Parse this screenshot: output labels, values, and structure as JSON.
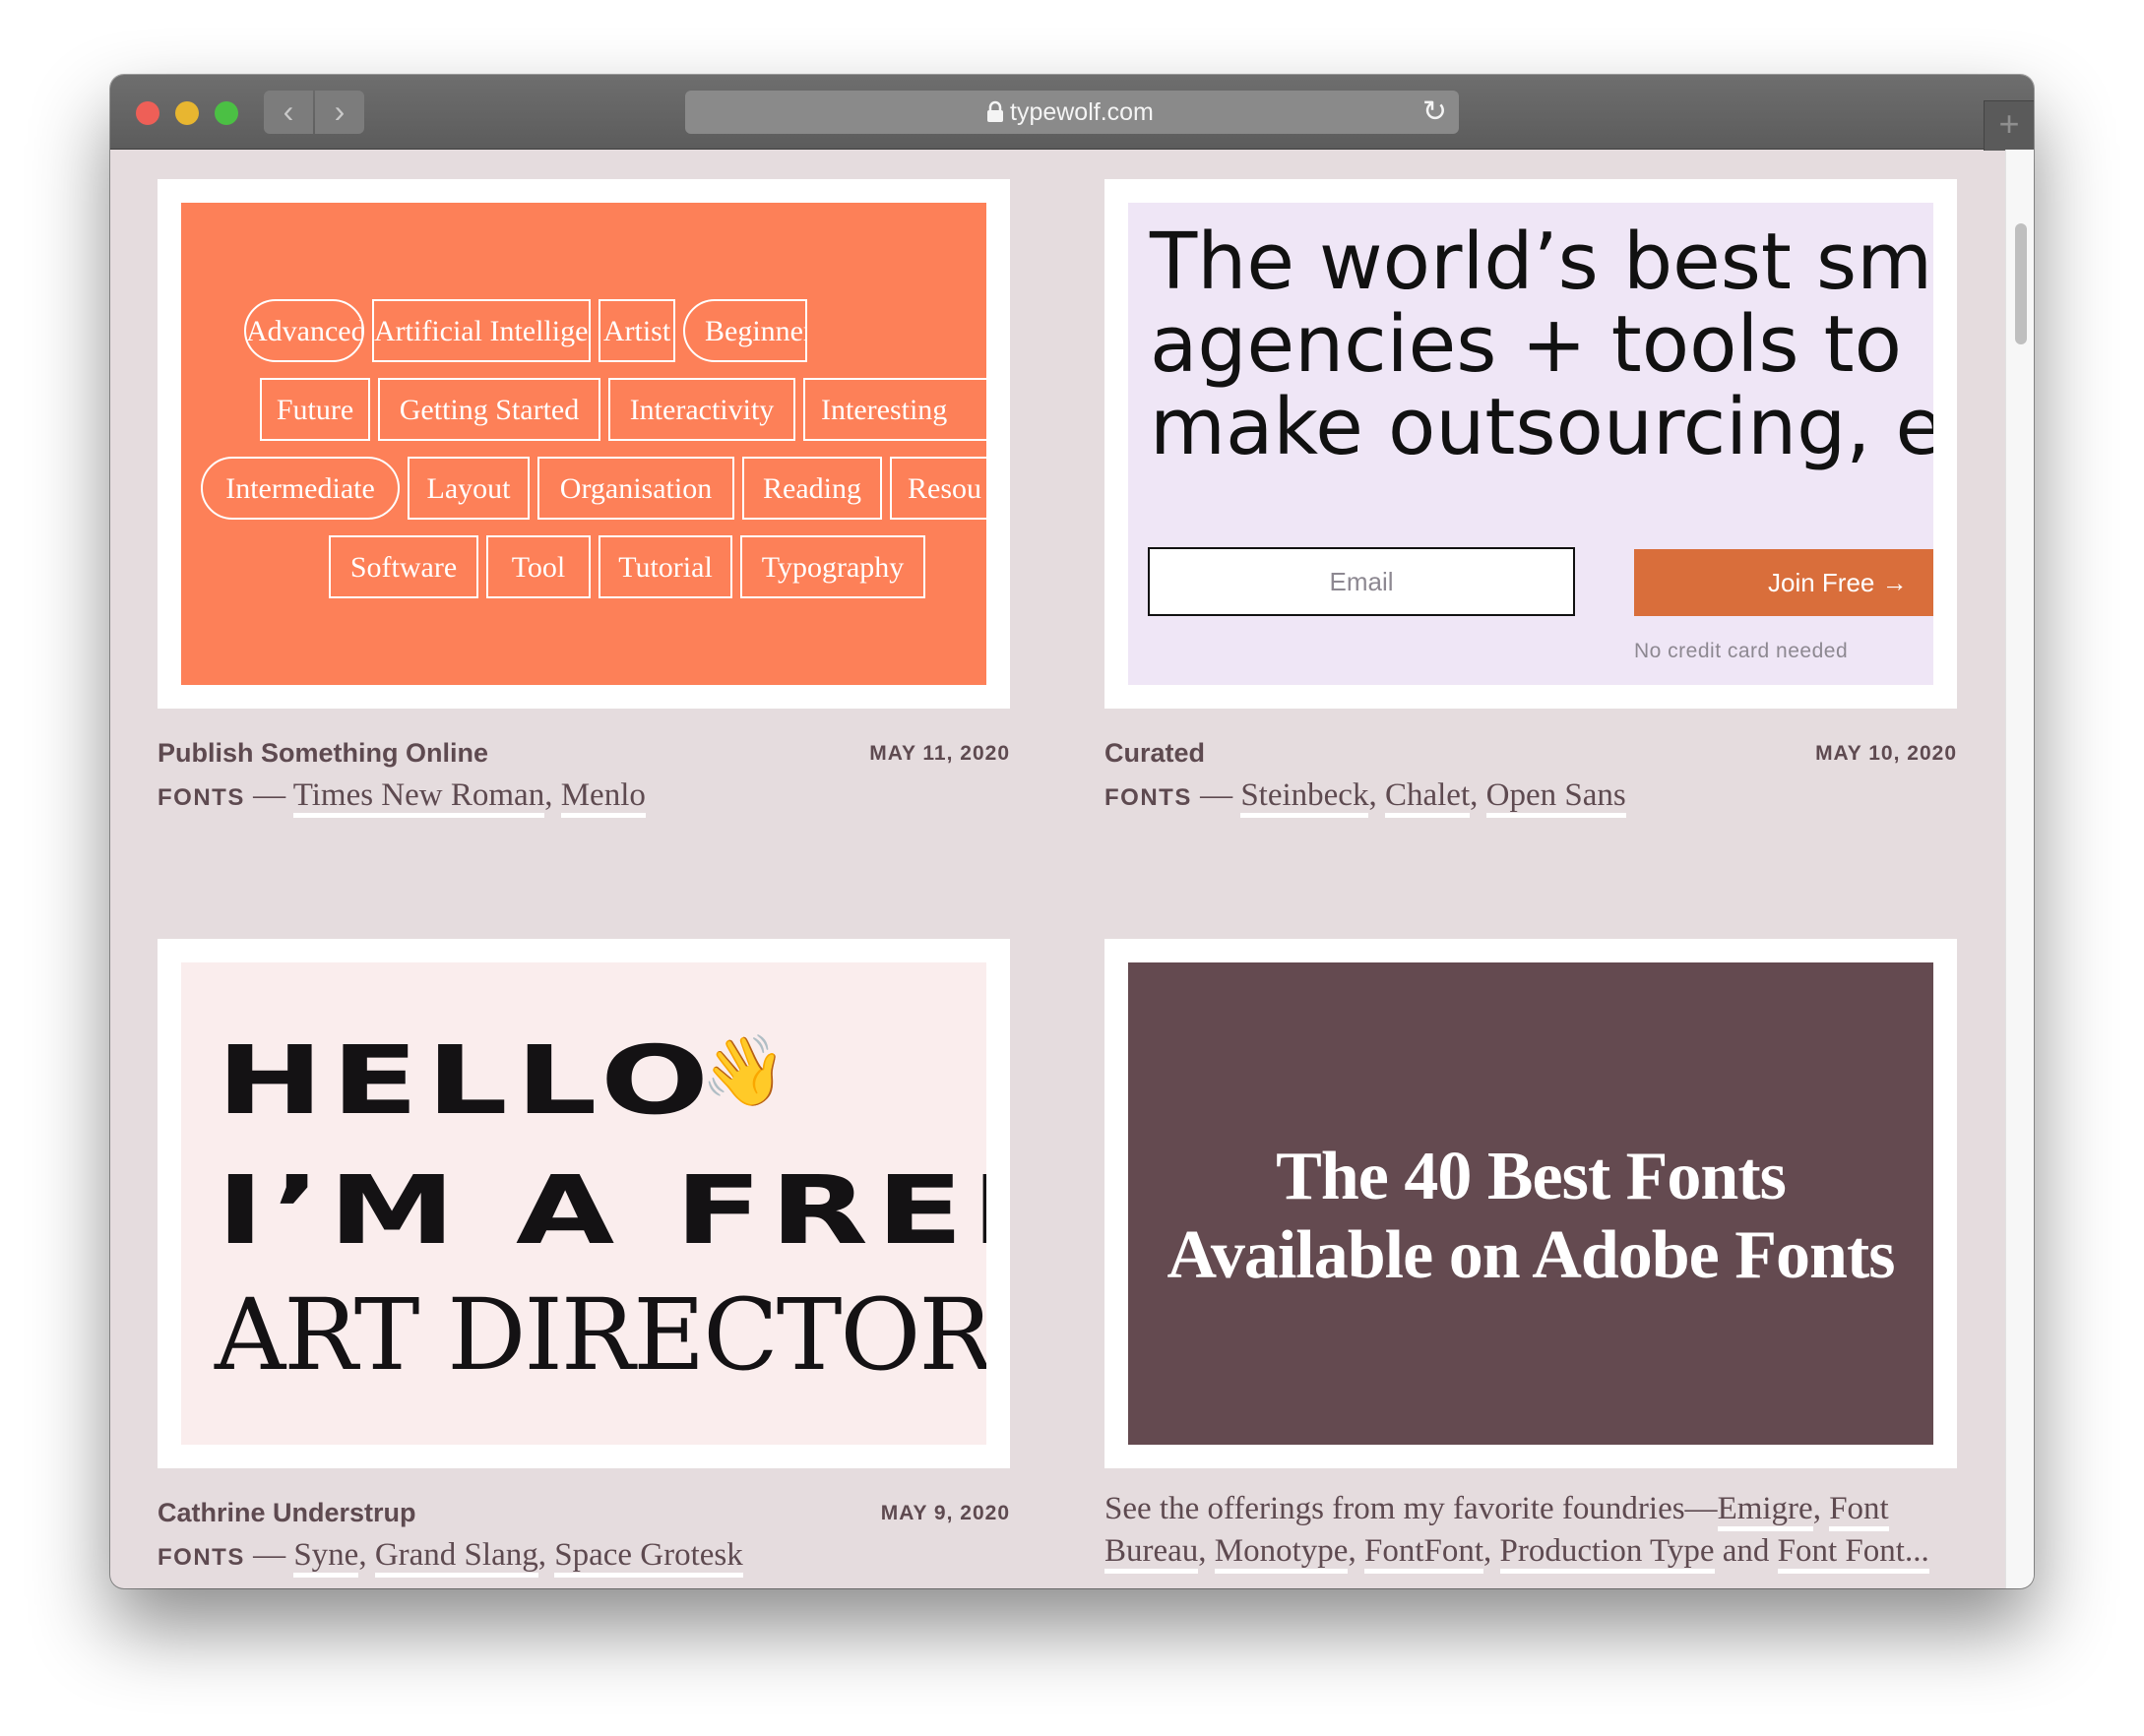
{
  "browser": {
    "url": "typewolf.com",
    "back_label": "‹",
    "forward_label": "›",
    "reload_label": "↻",
    "new_tab_label": "+"
  },
  "colors": {
    "page_background": "#e5dcde",
    "tag_card": "#fd8058",
    "ad_card": "#efe6f6",
    "ad_button": "#d96e3b",
    "hello_card": "#faeded",
    "adobe_card": "#644a50",
    "meta_text": "#5e4a50"
  },
  "posts": [
    {
      "title": "Publish Something Online",
      "date": "MAY 11, 2020",
      "fonts_label": "FONTS",
      "separator": " — ",
      "fonts": [
        "Times New Roman",
        "Menlo"
      ]
    },
    {
      "title": "Curated",
      "date": "MAY 10, 2020",
      "fonts_label": "FONTS",
      "separator": " — ",
      "fonts": [
        "Steinbeck",
        "Chalet",
        "Open Sans"
      ]
    },
    {
      "title": "Cathrine Understrup",
      "date": "MAY 9, 2020",
      "fonts_label": "FONTS",
      "separator": " — ",
      "fonts": [
        "Syne",
        "Grand Slang",
        "Space Grotesk"
      ]
    }
  ],
  "tag_cloud": {
    "tags": [
      "Advanced",
      "Artificial Intelligence",
      "Artist",
      "Beginner",
      "Future",
      "Getting Started",
      "Interactivity",
      "Interesting",
      "Intermediate",
      "Layout",
      "Organisation",
      "Reading",
      "Resou",
      "Software",
      "Tool",
      "Tutorial",
      "Typography"
    ]
  },
  "ad": {
    "headline_lines": [
      "The world’s best sm",
      "agencies + tools to",
      "make outsourcing, e"
    ],
    "email_placeholder": "Email",
    "join_label": "Join Free →",
    "note": "No credit card needed"
  },
  "hello_card": {
    "line1": "HELLO",
    "line2": "I’M A FREEL",
    "line3": "ART DIRECTOR",
    "emoji": "👋"
  },
  "adobe_card": {
    "title_line1": "The 40 Best Fonts",
    "title_line2": "Available on Adobe Fonts"
  },
  "adobe_desc": {
    "lead": "See the offerings from my favorite foundries—",
    "foundries": [
      "Emigre",
      "Font Bureau",
      "Monotype",
      "FontFont",
      "Production Type"
    ],
    "tail_word": "and",
    "last_foundry": "Font Font..."
  }
}
